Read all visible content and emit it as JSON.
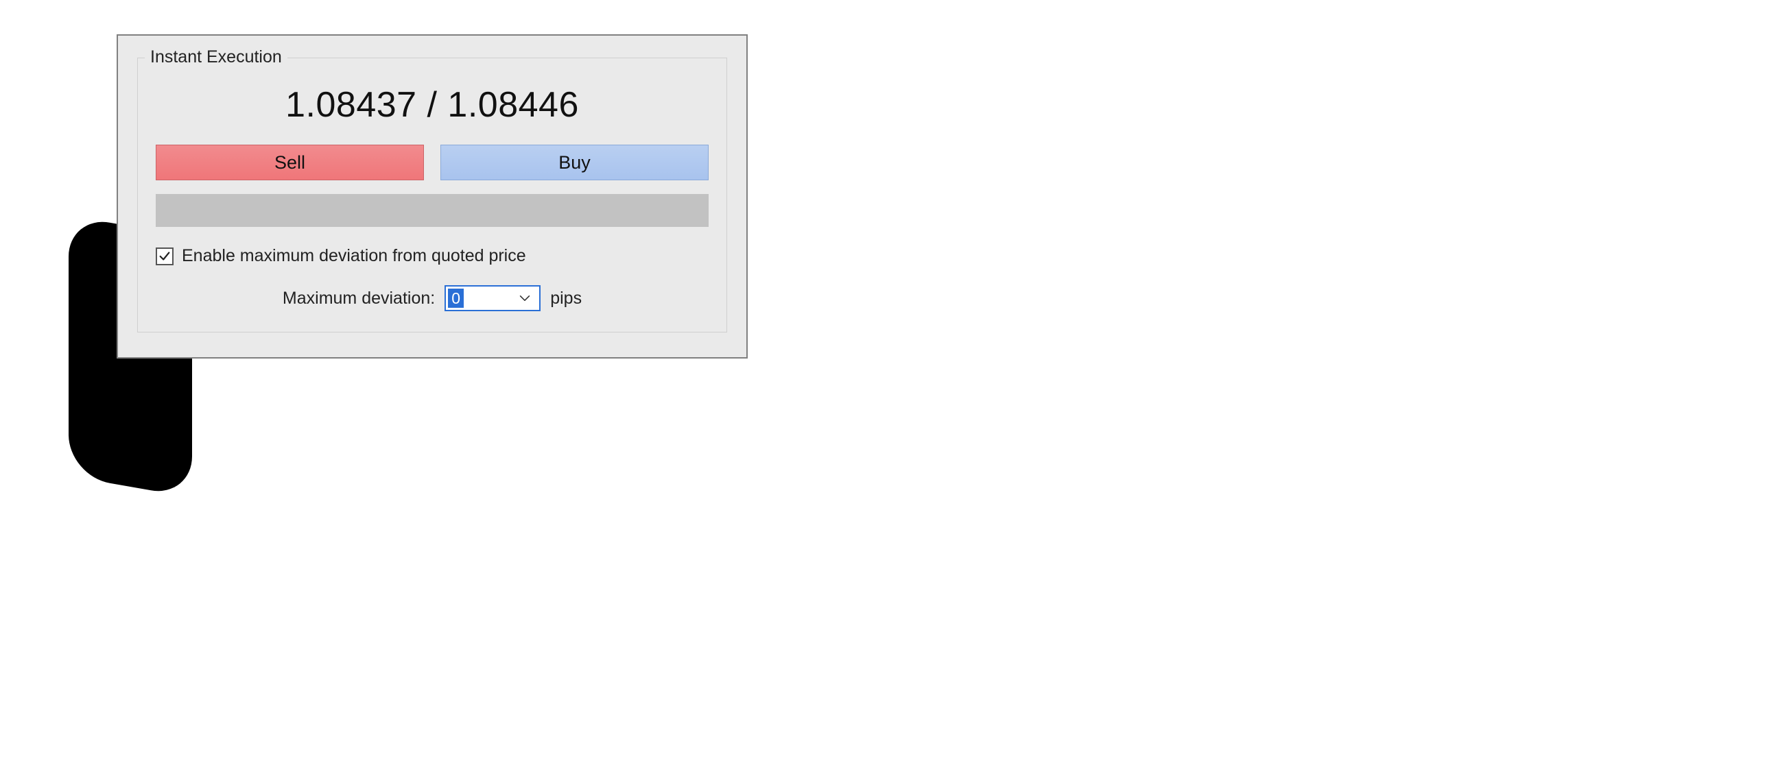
{
  "panel": {
    "legend": "Instant Execution",
    "bid_price": "1.08437",
    "ask_price": "1.08446",
    "price_separator": " / ",
    "sell_label": "Sell",
    "buy_label": "Buy",
    "enable_deviation_checked": true,
    "enable_deviation_label": "Enable maximum deviation from quoted price",
    "max_deviation_label": "Maximum deviation:",
    "max_deviation_value": "0",
    "pips_label": "pips"
  }
}
